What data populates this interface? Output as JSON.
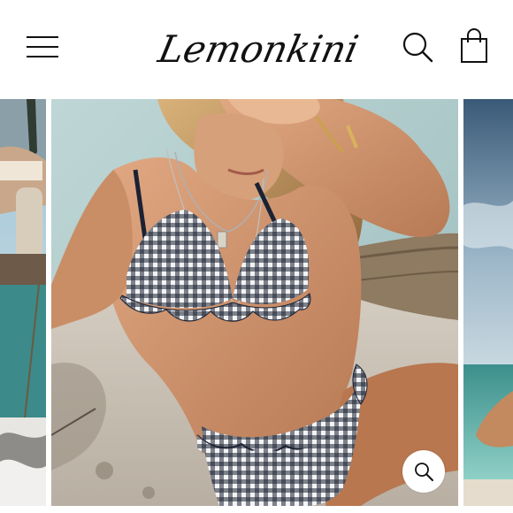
{
  "header": {
    "logo_text": "Lemonkini",
    "menu_icon": "hamburger-menu-icon",
    "search_icon": "search-icon",
    "cart_icon": "shopping-bag-icon"
  },
  "gallery": {
    "zoom_icon": "magnifier-zoom-icon",
    "slides": [
      "partial-previous-photo",
      "model-gingham-ruffle-bikini-photo",
      "partial-next-photo"
    ]
  },
  "colors": {
    "text": "#111111",
    "background": "#ffffff",
    "gingham_navy": "#1c2233"
  }
}
